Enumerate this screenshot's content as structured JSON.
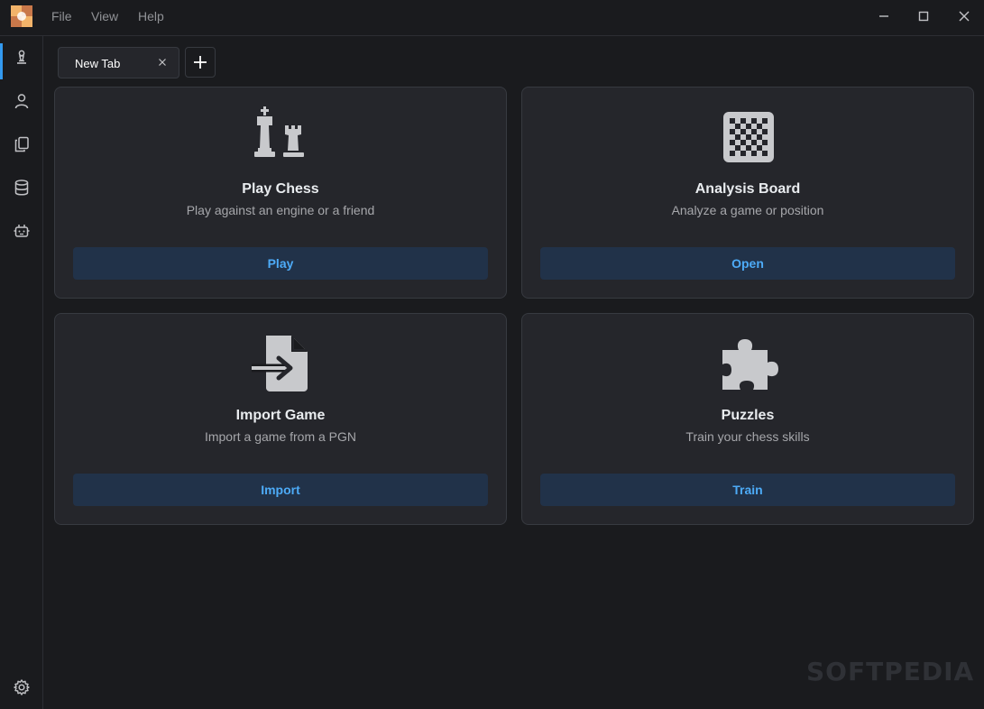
{
  "menu": {
    "file": "File",
    "view": "View",
    "help": "Help"
  },
  "tabs": [
    {
      "label": "New Tab"
    }
  ],
  "cards": [
    {
      "title": "Play Chess",
      "description": "Play against an engine or a friend",
      "button": "Play",
      "icon": "chess-pieces-icon"
    },
    {
      "title": "Analysis Board",
      "description": "Analyze a game or position",
      "button": "Open",
      "icon": "chessboard-icon"
    },
    {
      "title": "Import Game",
      "description": "Import a game from a PGN",
      "button": "Import",
      "icon": "file-import-icon"
    },
    {
      "title": "Puzzles",
      "description": "Train your chess skills",
      "button": "Train",
      "icon": "puzzle-icon"
    }
  ],
  "sidebar": {
    "items": [
      "pawn-icon",
      "user-icon",
      "files-icon",
      "database-icon",
      "robot-icon"
    ],
    "footer": "gear-icon"
  },
  "watermark": "SOFTPEDIA",
  "colors": {
    "accent": "#339af0",
    "button_bg": "#213249",
    "button_text": "#4dabf7",
    "card_bg": "#25262b",
    "app_bg": "#1a1b1e"
  }
}
